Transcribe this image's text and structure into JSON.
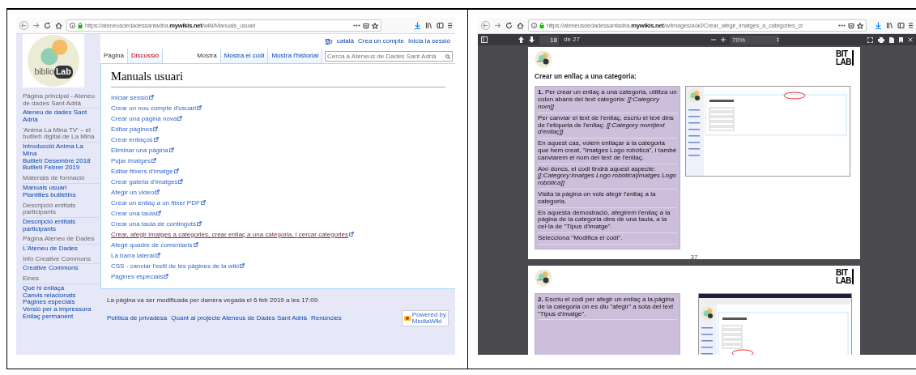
{
  "left_window": {
    "url": "https://ateneusdedadessantadria.**mywikis.net**/wiki/Manuals_usuari",
    "logo": {
      "word_1": "biblio",
      "word_2": "Lab"
    },
    "user_links": [
      "català",
      "Crea un compte",
      "Inicia la sessió"
    ],
    "page_tabs": [
      {
        "label": "Pàgina",
        "selected": true,
        "missing": false
      },
      {
        "label": "Discussió",
        "selected": false,
        "missing": true
      }
    ],
    "view_tabs": [
      {
        "label": "Mostra",
        "selected": true
      },
      {
        "label": "Mostra el codi",
        "selected": false
      },
      {
        "label": "Mostra l'historial",
        "selected": false
      }
    ],
    "search": {
      "placeholder": "Cerca a Ateneus de Dades Sant Adrià"
    },
    "sidebar": [
      {
        "heading": "Pàgina principal - Ateneu de dades Sant Adrià",
        "items": [
          "Ateneu de dades Sant Adrià"
        ]
      },
      {
        "heading": "'Anima La Mina TV' – el butlletí digital de La Mina",
        "items": [
          "Introducció Anima La Mina",
          "Butlletí Desembre 2018",
          "Butlletí Febrer 2019"
        ]
      },
      {
        "heading": "Materials de formació",
        "items": [
          "Manuals usuari",
          "Plantilles butlletins"
        ]
      },
      {
        "heading": "Descripció entitats participants",
        "items": [
          "Descripció entitats participants"
        ]
      },
      {
        "heading": "Pàgina Ateneu de Dades",
        "items": [
          "L'Ateneu de Dades"
        ]
      },
      {
        "heading": "Info Creative Commons",
        "items": [
          "Creative Commons"
        ]
      },
      {
        "heading": "Eines",
        "items": [
          "Què hi enllaça",
          "Canvis relacionats",
          "Pàgines especials",
          "Versió per a impressora",
          "Enllaç permanent"
        ]
      }
    ],
    "title": "Manuals usuari",
    "links": [
      {
        "label": "Iniciar sessió",
        "visited": false
      },
      {
        "label": "Crear un nou compte d'usuari",
        "visited": false
      },
      {
        "label": "Crear una pàgina nova",
        "visited": false
      },
      {
        "label": "Editar pàgines",
        "visited": false
      },
      {
        "label": "Crear enllaços",
        "visited": false
      },
      {
        "label": "Eliminar una pàgina",
        "visited": false
      },
      {
        "label": "Pujar imatges",
        "visited": false
      },
      {
        "label": "Editar fitxers d'imatge",
        "visited": false
      },
      {
        "label": "Crear galeria d'imatges",
        "visited": false
      },
      {
        "label": "Afegir un video",
        "visited": false
      },
      {
        "label": "Crear un enllaç a un fitxer PDF",
        "visited": false
      },
      {
        "label": "Crear una taula",
        "visited": false
      },
      {
        "label": "Crear una taula de continguts",
        "visited": false
      },
      {
        "label": "Crear, afegir imatges a categories, crear enllaç a una categoria, i cercar categories",
        "visited": true
      },
      {
        "label": "Afegir quadre de comentaris",
        "visited": false
      },
      {
        "label": "La barra lateral",
        "visited": false
      },
      {
        "label": "CSS - canviar l'estil de les pàgines de la wiki",
        "visited": false
      },
      {
        "label": "Pàgines especials",
        "visited": false
      }
    ],
    "footer": {
      "info": "La pàgina va ser modificada per darrera vegada el 6 feb 2019 a les 17:09.",
      "links": [
        "Política de privadesa",
        "Quant al projecte Ateneus de Dades Sant Adrià",
        "Renúncies"
      ],
      "badge": [
        "Powered by",
        "MediaWiki"
      ]
    }
  },
  "right_window": {
    "url": "https://ateneusdedadessantadria.**mywikis.net**/w/images/a/a0/Crear_afegir_imatges_a_categories_cr",
    "pdf_toolbar": {
      "page": "18",
      "page_count": "de 27",
      "zoom": "70%"
    },
    "pages": [
      {
        "brand": [
          "BIT",
          "LAB"
        ],
        "title": "Crear un enllaç a una categoria:",
        "notes": [
          "**1.** Per crear un enllaç a una categoria, utilitza un colon abans del text categoria: *[[:Category nom]]*",
          "Per canviar el text de l'enllaç, escriu el text dins de l'etiqueta de l'enllaç: *[[:Category nom|text d'enllaç]]*",
          "En aquest cas, volem enllaçar a la categoria que hem creat, \"Imatges Logo robòtica\", i també canviarem el nom del text de l'enllaç.",
          "Així doncs, el codi tindrà aquest aspecte: *[[:Category:Imatges Logo robòtica|Imatges Logo robòtica]]*",
          "Visita la pàgina on vols afegir l'enllaç a la categoria.",
          "En aquesta demostració, afegirem l'enllaç a la pàgina de la categoria dins de una taula, a la cel·la de \"Tipus d'imatge\".",
          "Selecciona \"Modifica el codi\"."
        ],
        "page_number": "37"
      },
      {
        "brand": [
          "BIT",
          "LAB"
        ],
        "notes": [
          "**2.** Escriu el codi per afegir un enllaç a la pàgina de la categoria on es diu \"afegir\" a sota del text \"Tipus d'imatge\"."
        ]
      }
    ]
  }
}
